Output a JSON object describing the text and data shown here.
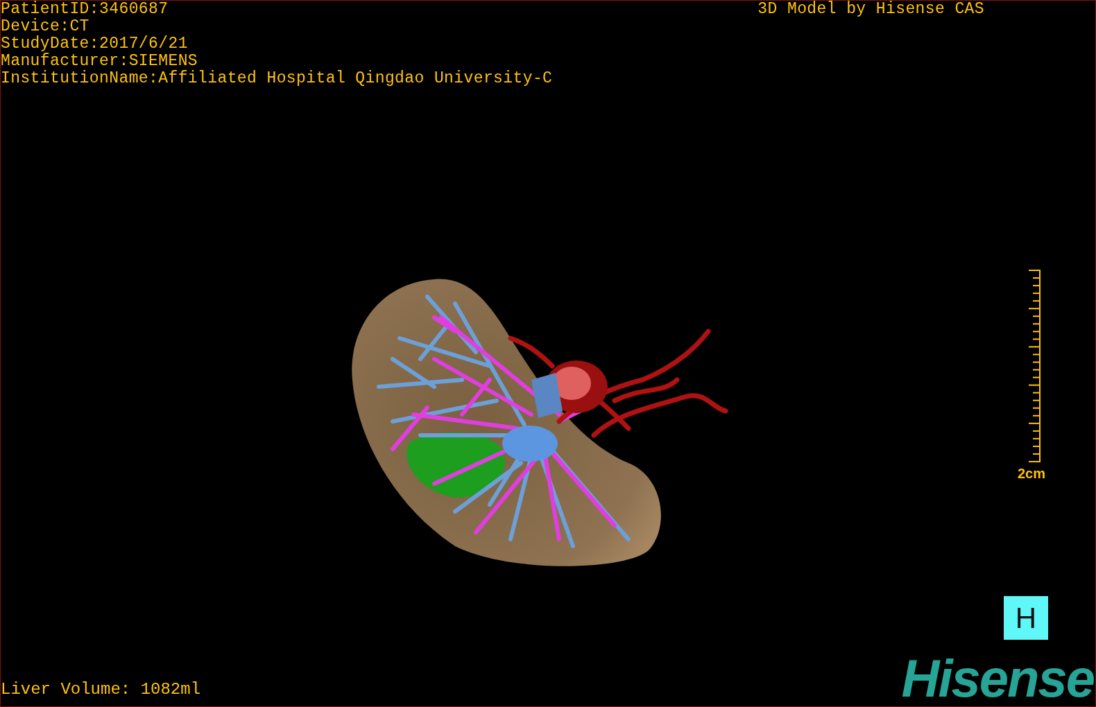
{
  "study_info": [
    "PatientID:3460687",
    "Device:CT",
    "StudyDate:2017/6/21",
    "Manufacturer:SIEMENS",
    "InstitutionName:Affiliated Hospital Qingdao University-C"
  ],
  "credit": "3D Model by Hisense CAS",
  "scale": {
    "label": "2cm"
  },
  "liver_volume": "Liver Volume: 1082ml",
  "view_button": "H",
  "logo": "Hisense"
}
